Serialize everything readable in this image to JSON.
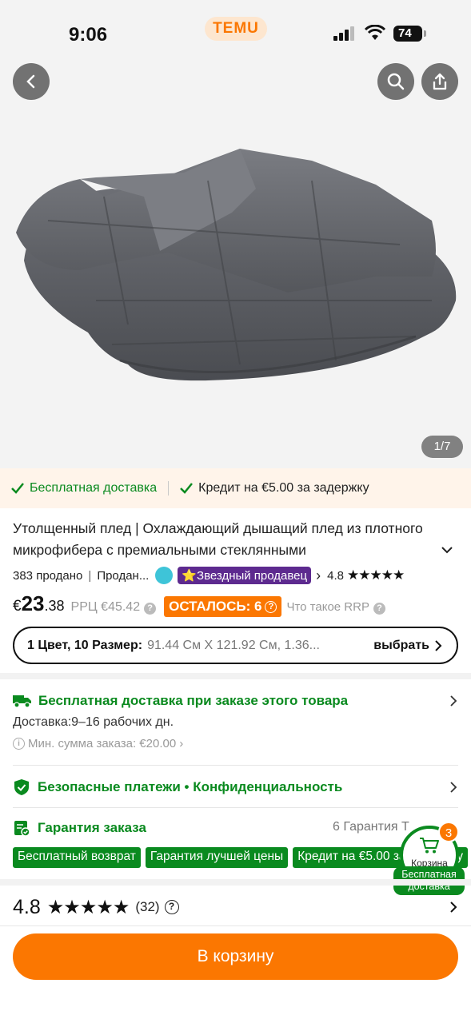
{
  "status_bar": {
    "time": "9:06",
    "brand": "TEMU",
    "battery": "74"
  },
  "hero": {
    "image_counter": "1/7"
  },
  "benefits": {
    "free_shipping": "Бесплатная доставка",
    "credit": "Кредит на €5.00 за задержку"
  },
  "product": {
    "title": "Утолщенный плед | Охлаждающий дышащий плед из плотного микрофибера с премиальными стеклянными",
    "sold": "383 продано",
    "seller": "Продан...",
    "star_seller": "⭐Звездный продавец",
    "rating": "4.8"
  },
  "price": {
    "currency": "€",
    "whole": "23",
    "cents": ".38",
    "rrp": "РРЦ €45.42",
    "stock_badge": "ОСТАЛОСЬ: 6",
    "what_is_rrp": "Что такое RRP"
  },
  "variant": {
    "label": "1 Цвет, 10 Размер:",
    "value": "91.44 См X 121.92 См, 1.36...",
    "select": "выбрать"
  },
  "shipping": {
    "title": "Бесплатная доставка при заказе этого товара",
    "delivery_label": "Доставка:",
    "delivery_value": "9–16 рабочих дн.",
    "min_order": "Мин. сумма заказа: €20.00"
  },
  "security": {
    "text": "Безопасные платежи • Конфиденциальность"
  },
  "guarantee": {
    "title": "Гарантия заказа",
    "count": "6 Гарантия Т",
    "tags": [
      "Бесплатный возврат",
      "Гарантия лучшей цены",
      "Кредит на €5.00 за задержку"
    ]
  },
  "cart": {
    "count": "3",
    "label": "Корзина",
    "free_shipping": "Бесплатная доставка"
  },
  "reviews": {
    "score": "4.8",
    "stars": "★★★★★",
    "count": "(32)"
  },
  "add_to_cart": "В корзину",
  "colors": {
    "accent": "#fb7701",
    "green": "#0a8a1f",
    "star_seller": "#5d2a8f"
  }
}
